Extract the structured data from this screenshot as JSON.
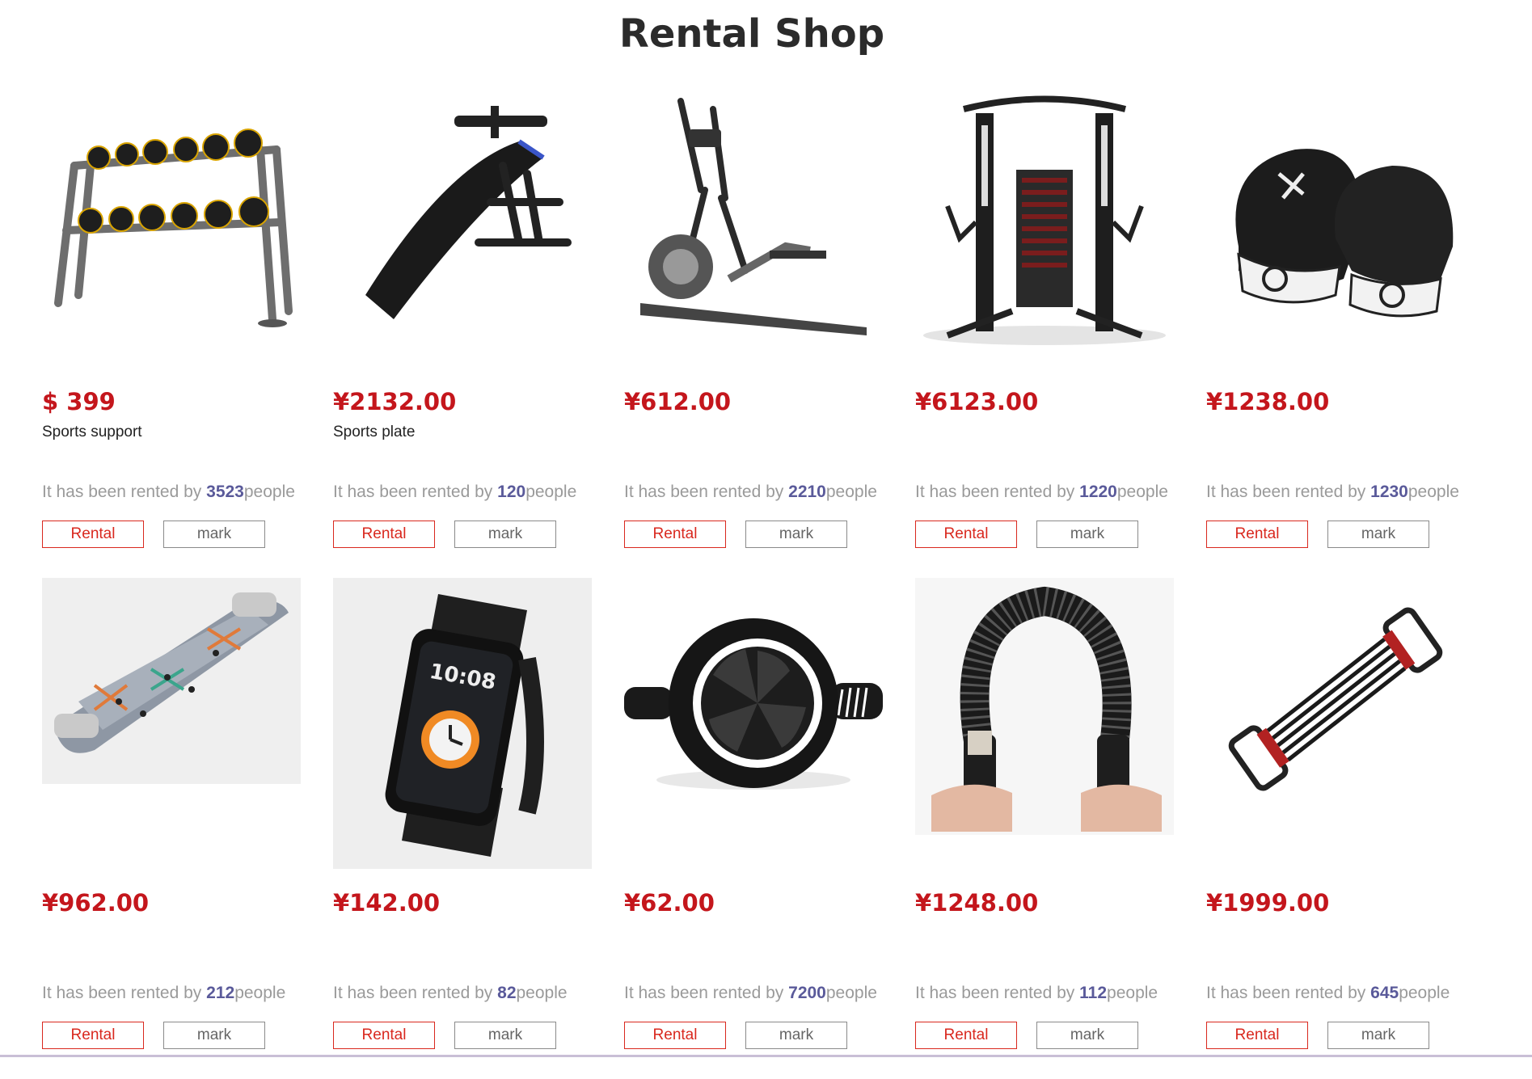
{
  "page": {
    "title": "Rental Shop"
  },
  "labels": {
    "rented_prefix": "It has been rented by ",
    "rented_suffix": "people",
    "rental_button": "Rental",
    "mark_button": "mark"
  },
  "products": [
    {
      "price": "$ 399",
      "name": "Sports support",
      "rented_count": "3523",
      "image_icon": "dumbbell-rack-icon"
    },
    {
      "price": "¥2132.00",
      "name": "Sports plate",
      "rented_count": "120",
      "image_icon": "sit-up-bench-icon"
    },
    {
      "price": "¥612.00",
      "name": "",
      "rented_count": "2210",
      "image_icon": "elliptical-trainer-icon"
    },
    {
      "price": "¥6123.00",
      "name": "",
      "rented_count": "1220",
      "image_icon": "cable-machine-icon"
    },
    {
      "price": "¥1238.00",
      "name": "",
      "rented_count": "1230",
      "image_icon": "boxing-gloves-icon"
    },
    {
      "price": "¥962.00",
      "name": "",
      "rented_count": "212",
      "image_icon": "push-up-board-icon"
    },
    {
      "price": "¥142.00",
      "name": "",
      "rented_count": "82",
      "image_icon": "smartwatch-icon"
    },
    {
      "price": "¥62.00",
      "name": "",
      "rented_count": "7200",
      "image_icon": "ab-wheel-icon"
    },
    {
      "price": "¥1248.00",
      "name": "",
      "rented_count": "112",
      "image_icon": "power-twister-icon"
    },
    {
      "price": "¥1999.00",
      "name": "",
      "rented_count": "645",
      "image_icon": "chest-expander-icon"
    }
  ],
  "colors": {
    "price": "#c4161c",
    "rental_border": "#d9281e",
    "count": "#5a5a9a"
  }
}
